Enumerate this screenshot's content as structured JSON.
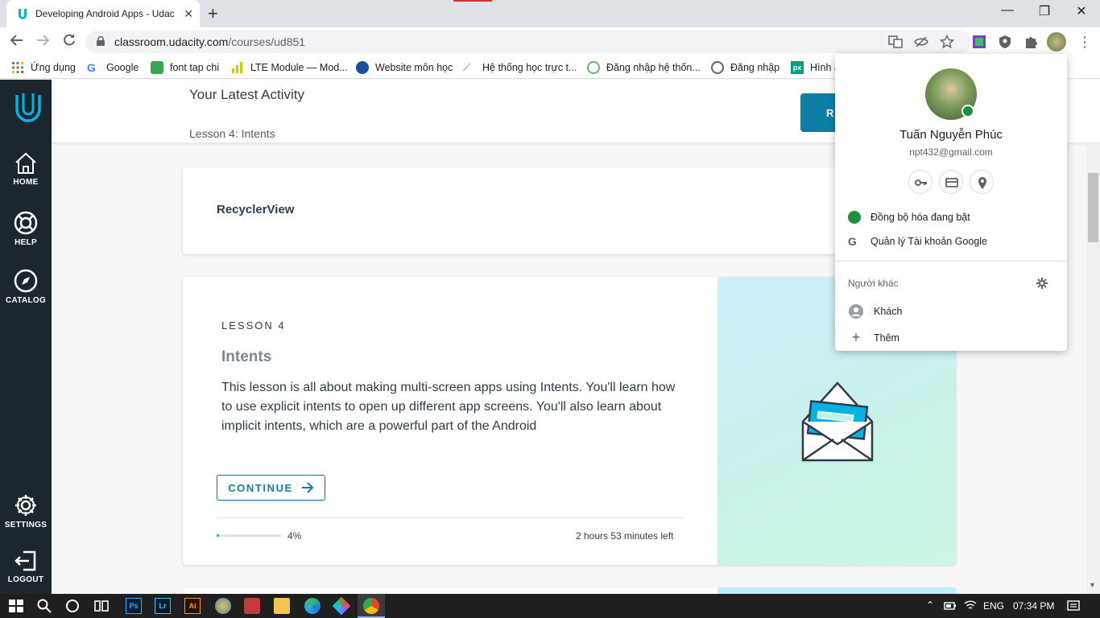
{
  "browser": {
    "tab_title": "Developing Android Apps - Udac",
    "url_host": "classroom.udacity.com",
    "url_path": "/courses/ud851",
    "bookmarks": [
      "Ứng dụng",
      "Google",
      "font tap chi",
      "LTE Module — Mod...",
      "Website môn học",
      "Hệ thống học trực t...",
      "Đăng nhập hệ thốn...",
      "Đăng nhập",
      "Hình a"
    ]
  },
  "sidebar": {
    "items": [
      {
        "label": "HOME",
        "icon": "home-icon"
      },
      {
        "label": "HELP",
        "icon": "lifebuoy-icon"
      },
      {
        "label": "CATALOG",
        "icon": "compass-icon"
      },
      {
        "label": "SETTINGS",
        "icon": "gear-icon"
      },
      {
        "label": "LOGOUT",
        "icon": "logout-icon"
      }
    ]
  },
  "latest": {
    "title": "Your Latest Activity",
    "subtitle": "Lesson 4: Intents",
    "resume_label": "R"
  },
  "recycler": {
    "title": "RecyclerView"
  },
  "lesson": {
    "label": "LESSON 4",
    "name": "Intents",
    "description": "This lesson is all about making multi-screen apps using Intents. You'll learn how to use explicit intents to open up different app screens. You'll also learn about implicit intents, which are a powerful part of the Android",
    "continue_label": "CONTINUE",
    "progress_fraction": 0.04,
    "progress_text": "4%",
    "time_left": "2 hours 53 minutes left"
  },
  "profile": {
    "name": "Tuấn Nguyễn Phúc",
    "email": "npt432@gmail.com",
    "sync": "Đồng bộ hóa đang bật",
    "manage": "Quản lý Tài khoản Google",
    "others": "Người khác",
    "guest": "Khách",
    "add": "Thêm"
  },
  "taskbar": {
    "lang": "ENG",
    "time": "07:34 PM"
  },
  "colors": {
    "udacity_teal": "#0f7ea6",
    "sidebar": "#1c262f",
    "progress": "#02ccba",
    "sync_green": "#1e8e3e"
  }
}
